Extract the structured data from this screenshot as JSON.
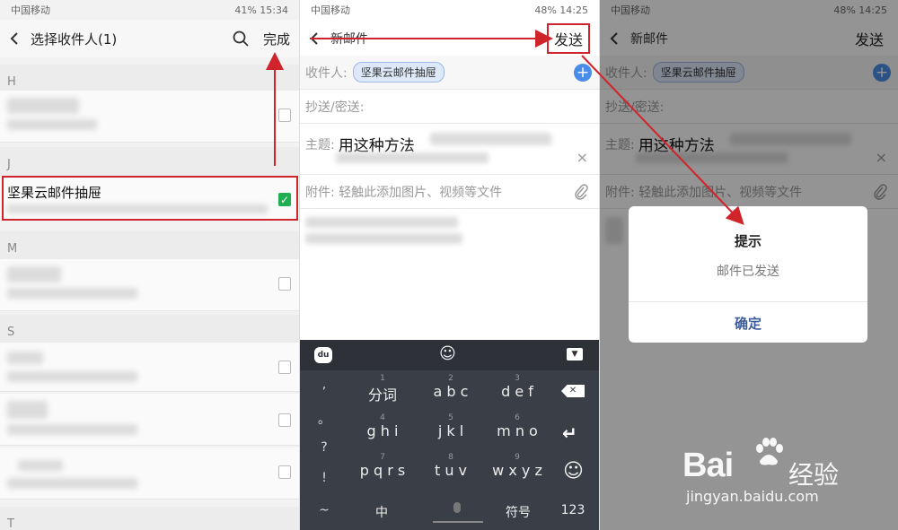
{
  "panel1": {
    "status": {
      "carrier": "中国移动",
      "right": "41% 15:34"
    },
    "header": {
      "title": "选择收件人(1)",
      "done_label": "完成"
    },
    "sections": [
      "H",
      "J",
      "M",
      "S",
      "T"
    ],
    "selected_contact": {
      "name": "坚果云邮件抽屉",
      "checked": true
    }
  },
  "panel2": {
    "status": {
      "carrier": "中国移动",
      "right": "48% 14:25"
    },
    "header": {
      "title": "新邮件",
      "send_label": "发送"
    },
    "fields": {
      "to_label": "收件人:",
      "to_chip": "坚果云邮件抽屉",
      "cc_label": "抄送/密送:",
      "subject_label": "主题:",
      "subject_value": "用这种方法",
      "attach_label": "附件: 轻触此添加图片、视频等文件"
    },
    "keyboard": {
      "side_keys": [
        ",",
        "。",
        "?",
        "!",
        "~"
      ],
      "rows": [
        [
          {
            "num": "1",
            "label": "分词"
          },
          {
            "num": "2",
            "label": "a b c"
          },
          {
            "num": "3",
            "label": "d e f"
          }
        ],
        [
          {
            "num": "4",
            "label": "g h i"
          },
          {
            "num": "5",
            "label": "j k l"
          },
          {
            "num": "6",
            "label": "m n o"
          }
        ],
        [
          {
            "num": "7",
            "label": "p q r s"
          },
          {
            "num": "8",
            "label": "t u v"
          },
          {
            "num": "9",
            "label": "w x y z"
          }
        ]
      ],
      "bottom": {
        "zh": "中",
        "symbols": "符号",
        "num": "123"
      }
    }
  },
  "panel3": {
    "status": {
      "carrier": "中国移动",
      "right": "48% 14:25"
    },
    "header": {
      "title": "新邮件",
      "send_label": "发送"
    },
    "fields": {
      "to_label": "收件人:",
      "to_chip": "坚果云邮件抽屉",
      "cc_label": "抄送/密送:",
      "subject_label": "主题:",
      "subject_value": "用这种方法",
      "attach_label": "附件: 轻触此添加图片、视频等文件"
    },
    "dialog": {
      "title": "提示",
      "message": "邮件已发送",
      "ok_label": "确定"
    }
  },
  "watermark": {
    "brand": "Bai",
    "brand_suffix": "经验",
    "url": "jingyan.baidu.com"
  },
  "colors": {
    "annotation_red": "#d0242b",
    "check_green": "#1fae52",
    "chip_blue": "#dde8f8"
  }
}
